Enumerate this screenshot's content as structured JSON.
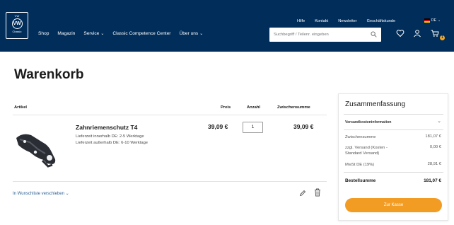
{
  "logo": {
    "top_text": "VW",
    "circle_text": "VW",
    "bottom_text": "Classic"
  },
  "mainnav": [
    {
      "label": "Shop",
      "chev": ""
    },
    {
      "label": "Magazin",
      "chev": ""
    },
    {
      "label": "Service",
      "chev": "⌄"
    },
    {
      "label": "Classic Competence Center",
      "chev": ""
    },
    {
      "label": "Über uns",
      "chev": "⌄"
    }
  ],
  "topnav": [
    "Hilfe",
    "Kontakt",
    "Newsletter",
    "Geschäftskunde"
  ],
  "lang": {
    "code": "DE",
    "chev": "⌄"
  },
  "search": {
    "placeholder": "Suchbegriff / Teilenr. eingeben"
  },
  "cart": {
    "badge": "1"
  },
  "page_title": "Warenkorb",
  "table_headers": {
    "article": "Artikel",
    "price": "Preis",
    "quantity": "Anzahl",
    "subtotal": "Zwischensumme"
  },
  "item": {
    "name": "Zahnriemenschutz T4",
    "delivery_de": "Lieferzeit innerhalb DE: 2-5 Werktage",
    "delivery_abroad": "Lieferzeit außerhalb DE: 6-10 Werktage",
    "price": "39,09 €",
    "quantity": "1",
    "subtotal": "39,09 €"
  },
  "wishlist_link": "In Wunschliste verschieben ⌄",
  "summary": {
    "title": "Zusammenfassung",
    "shipping_info": "Versandkosteninformation",
    "chev": "⌄",
    "rows": [
      {
        "label": "Zwischensumme",
        "value": "181,07 €"
      },
      {
        "label": "zzgl. Versand (Kosten - Standard Versand)",
        "value": "0,00 €"
      },
      {
        "label": "MwSt DE (19%)",
        "value": "28,91 €"
      }
    ],
    "total_label": "Bestellsumme",
    "total_value": "181,07 €",
    "checkout_label": "Zur Kasse"
  },
  "colors": {
    "header_bg": "#002d5a",
    "accent": "#f39c23",
    "link": "#2b5f95"
  }
}
